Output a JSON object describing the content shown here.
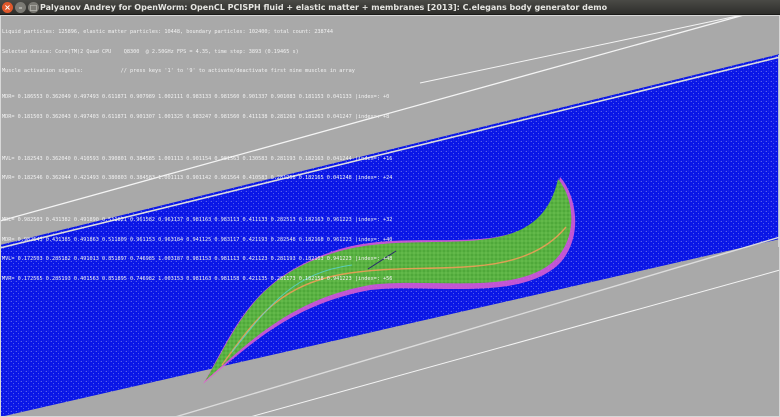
{
  "window": {
    "title": "Palyanov Andrey for OpenWorm: OpenCL PCISPH fluid + elastic matter + membranes [2013]: C.elegans body generator demo",
    "controls": {
      "close": "×",
      "minimize": "–",
      "maximize": "□"
    }
  },
  "overlay": {
    "header_lines": [
      "Liquid particles: 125896, elastic matter particles: 10448, boundary particles: 102400; total count: 238744",
      "Selected device: Core(TM)2 Quad CPU    Q8300  @ 2.50GHz FPS = 4.35, time step: 3893 (0.19465 s)",
      "Muscle activation signals:            // press keys '1' to '9' to activate/deactivate first nine muscles in array"
    ],
    "rows_group1": [
      "MDR= 0.186553 0.362049 0.497493 0.611871 0.907989 1.002111 0.983133 0.981560 0.901337 0.901083 0.181153 0.041133 |index=: +0",
      "MDR= 0.181503 0.362043 0.497403 0.611871 0.901307 1.001325 0.983247 0.981560 0.411138 0.281263 0.181263 0.041247 |index=: +8"
    ],
    "rows_group2": [
      "MVL= 0.182543 0.362040 0.410593 0.390801 0.384585 1.001113 0.901154 0.981563 0.130583 0.281193 0.182163 0.041244 |index=: +16",
      "MVR= 0.182546 0.362044 0.421493 0.380803 0.384583 1.001113 0.901142 0.961564 0.410583 0.281258 0.182165 0.041248 |index=: +24"
    ],
    "rows_group3": [
      "MDL= 0.982503 0.431382 0.491890 0.511821 0.961582 0.961137 0.981163 0.983113 0.411133 0.282513 0.182163 0.961223 |index=: +32",
      "MDR= 0.982543 0.431385 0.491863 0.511809 0.961153 0.963184 0.941125 0.983117 0.421193 0.282548 0.182168 0.961223 |index=: +40",
      "MVL= 0.172503 0.285182 0.491013 0.851897 0.746985 1.003187 0.981153 0.981113 0.421123 0.281193 0.182163 0.941223 |index=: +48",
      "MVR= 0.172565 0.285193 0.401563 0.851895 0.746982 1.003153 0.981163 0.981158 0.421135 0.281173 0.182158 0.941223 |index=: +56"
    ]
  },
  "colors": {
    "background": "#a9a9a9",
    "fluid": "#0a16e6",
    "body": "#4fa83a",
    "membrane": "#e25fd0",
    "tube_line": "#f4f4f4",
    "border": "#d8d8d8"
  }
}
